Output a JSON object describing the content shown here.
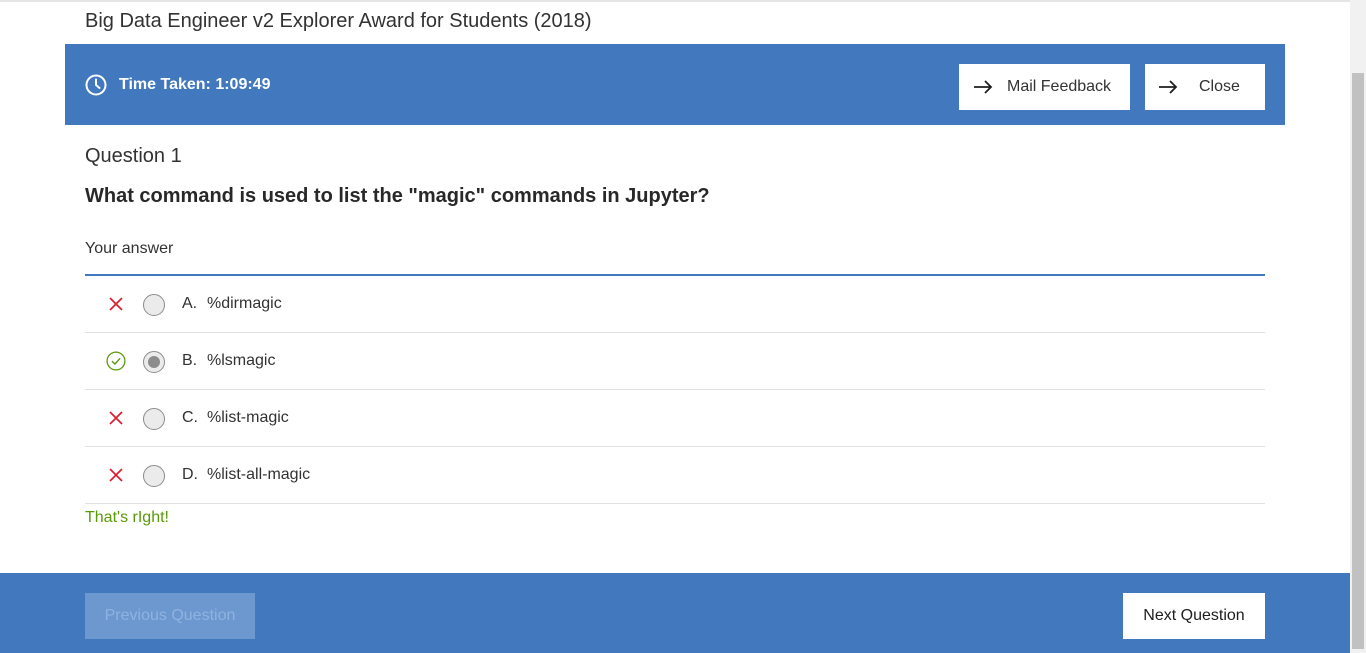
{
  "page": {
    "title": "Big Data Engineer v2 Explorer Award for Students (2018)"
  },
  "header": {
    "icon": "clock-icon",
    "time_taken": "Time Taken: 1:09:49",
    "mail_feedback_label": "Mail Feedback",
    "close_label": "Close",
    "accent_color": "#4178be"
  },
  "question": {
    "number_label": "Question 1",
    "text": "What command is used to list the \"magic\" commands in Jupyter?",
    "your_answer_label": "Your answer",
    "options": [
      {
        "letter": "A.",
        "text": "%dirmagic",
        "status": "incorrect",
        "selected": false
      },
      {
        "letter": "B.",
        "text": "%lsmagic",
        "status": "correct",
        "selected": true
      },
      {
        "letter": "C.",
        "text": "%list-magic",
        "status": "incorrect",
        "selected": false
      },
      {
        "letter": "D.",
        "text": "%list-all-magic",
        "status": "incorrect",
        "selected": false
      }
    ],
    "feedback": "That's rIght!",
    "correct_color": "#5a9a08",
    "incorrect_color": "#e0182d"
  },
  "footer": {
    "previous_label": "Previous Question",
    "next_label": "Next Question"
  }
}
